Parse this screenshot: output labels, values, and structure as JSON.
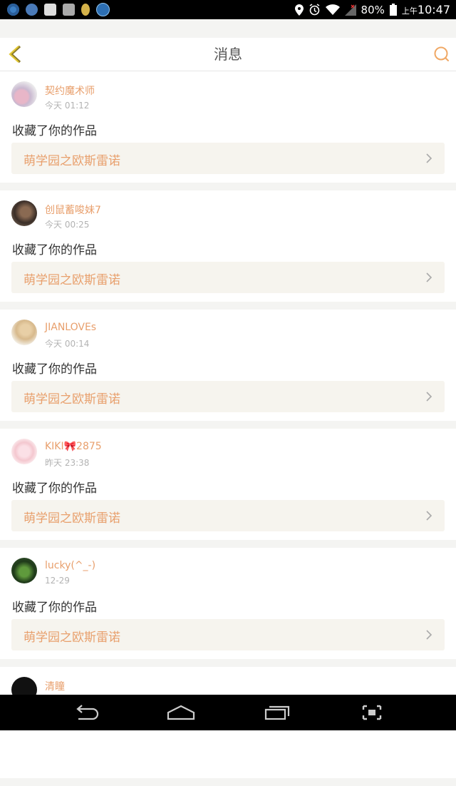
{
  "status_bar": {
    "battery": "80%",
    "ampm": "上午",
    "time": "10:47",
    "icons": [
      "app-icon",
      "browser-icon",
      "mail-icon",
      "gallery-icon",
      "notification-icon",
      "app-k-icon",
      "location-icon",
      "alarm-icon",
      "wifi-icon",
      "signal-icon",
      "battery-icon"
    ]
  },
  "header": {
    "title": "消息"
  },
  "messages": [
    {
      "user": "契约魔术师",
      "time": "今天 01:12",
      "action": "收藏了你的作品",
      "work": "萌学园之欧斯雷诺"
    },
    {
      "user": "创鼠蓄唆妹7",
      "time": "今天 00:25",
      "action": "收藏了你的作品",
      "work": "萌学园之欧斯雷诺"
    },
    {
      "user": "JIANLOVEs",
      "time": "今天 00:14",
      "action": "收藏了你的作品",
      "work": "萌学园之欧斯雷诺"
    },
    {
      "user": "KIKI🎀2875",
      "time": "昨天 23:38",
      "action": "收藏了你的作品",
      "work": "萌学园之欧斯雷诺"
    },
    {
      "user": "lucky(^_-)",
      "time": "12-29",
      "action": "收藏了你的作品",
      "work": "萌学园之欧斯雷诺"
    },
    {
      "user": "清瞳"
    }
  ],
  "colors": {
    "accent": "#e89f6c",
    "link_bg": "#f6f4ee",
    "page_bg": "#f4f4f2"
  }
}
